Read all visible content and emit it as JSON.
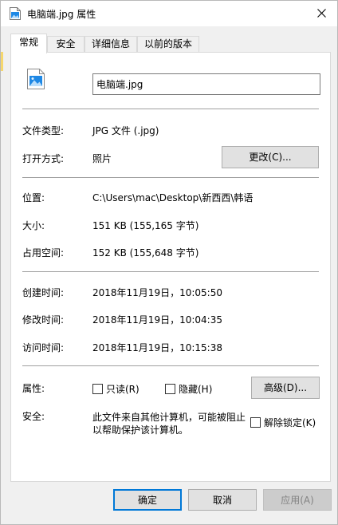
{
  "window": {
    "title": "电脑端.jpg 属性"
  },
  "tabs": [
    {
      "label": "常规"
    },
    {
      "label": "安全"
    },
    {
      "label": "详细信息"
    },
    {
      "label": "以前的版本"
    }
  ],
  "general": {
    "file_name": "电脑端.jpg",
    "type_label": "文件类型:",
    "type_value": "JPG 文件 (.jpg)",
    "opens_with_label": "打开方式:",
    "opens_with_value": "照片",
    "change_button": "更改(C)...",
    "location_label": "位置:",
    "location_value": "C:\\Users\\mac\\Desktop\\新西西\\韩语",
    "size_label": "大小:",
    "size_value": "151 KB (155,165 字节)",
    "size_on_disk_label": "占用空间:",
    "size_on_disk_value": "152 KB (155,648 字节)",
    "created_label": "创建时间:",
    "created_value": "2018年11月19日，10:05:50",
    "modified_label": "修改时间:",
    "modified_value": "2018年11月19日，10:04:35",
    "accessed_label": "访问时间:",
    "accessed_value": "2018年11月19日，10:15:38",
    "attributes_label": "属性:",
    "readonly_label": "只读(R)",
    "hidden_label": "隐藏(H)",
    "advanced_button": "高级(D)...",
    "security_label": "安全:",
    "security_text_line1": "此文件来自其他计算机，可能被阻止",
    "security_text_line2": "以帮助保护该计算机。",
    "unblock_label": "解除锁定(K)"
  },
  "footer": {
    "ok": "确定",
    "cancel": "取消",
    "apply": "应用(A)"
  },
  "colors": {
    "accent": "#0078d7",
    "image_icon": "#1e88e5"
  }
}
